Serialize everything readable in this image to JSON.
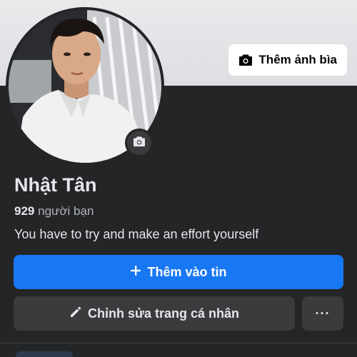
{
  "cover": {
    "add_cover_label": "Thêm ảnh bìa",
    "icon": "camera-icon"
  },
  "profile": {
    "avatar_icon": "camera-icon",
    "name": "Nhật Tân",
    "friends_count": "929",
    "friends_label": "người bạn",
    "bio": "You have to try and make an effort yourself"
  },
  "actions": {
    "add_story_label": "Thêm vào tin",
    "add_story_icon": "plus-icon",
    "edit_profile_label": "Chỉnh sửa trang cá nhân",
    "edit_icon": "pencil-icon",
    "more_label": "···"
  },
  "colors": {
    "background": "#242526",
    "primary": "#1877f2",
    "secondary_button": "#3a3b3c"
  }
}
